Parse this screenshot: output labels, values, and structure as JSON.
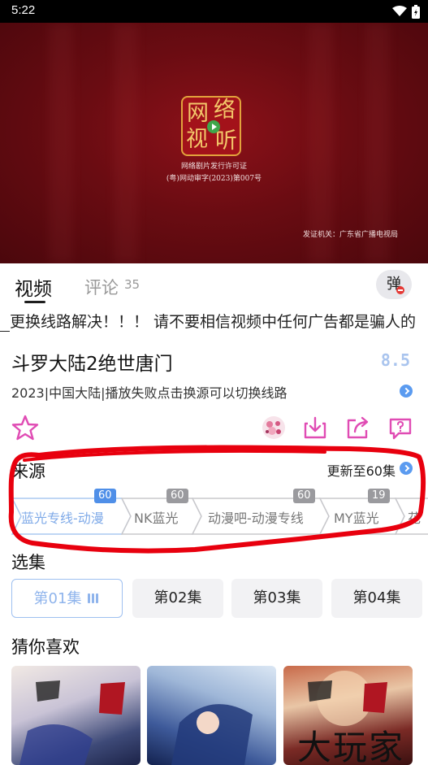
{
  "status_bar": {
    "time": "5:22"
  },
  "player": {
    "seal_chars": [
      "网",
      "络",
      "视",
      "听"
    ],
    "license_line1": "网络剧片发行许可证",
    "license_line2": "(粤)网动审字(2023)第007号",
    "issuer": "发证机关：广东省广播电视局"
  },
  "tabs": {
    "video": "视频",
    "comments": "评论",
    "comments_count": "35",
    "danmu": "弹"
  },
  "notice": "更换线路解决！！！ 请不要相信视频中任何广告都是骗人的",
  "show": {
    "title": "斗罗大陆2绝世唐门",
    "score": "8.5",
    "meta": "2023|中国大陆|播放失败点击换源可以切换线路"
  },
  "actions": [
    "star-icon",
    "avatar",
    "download-icon",
    "share-icon",
    "feedback-icon"
  ],
  "sources": {
    "title": "来源",
    "more": "更新至60集",
    "items": [
      {
        "label": "蓝光专线-动漫",
        "count": "60",
        "active": true
      },
      {
        "label": "NK蓝光",
        "count": "60",
        "active": false
      },
      {
        "label": "动漫吧-动漫专线",
        "count": "60",
        "active": false
      },
      {
        "label": "MY蓝光",
        "count": "19",
        "active": false
      },
      {
        "label": "花",
        "count": "",
        "active": false
      }
    ]
  },
  "episodes": {
    "title": "选集",
    "items": [
      {
        "label": "第01集",
        "active": true
      },
      {
        "label": "第02集",
        "active": false
      },
      {
        "label": "第03集",
        "active": false
      },
      {
        "label": "第04集",
        "active": false
      }
    ]
  },
  "recommend": {
    "title": "猜你喜欢"
  },
  "watermark": "大玩家",
  "colors": {
    "accent": "#5b9bf0",
    "annotation": "#e8000e",
    "player_bg": "#6a0c12"
  }
}
